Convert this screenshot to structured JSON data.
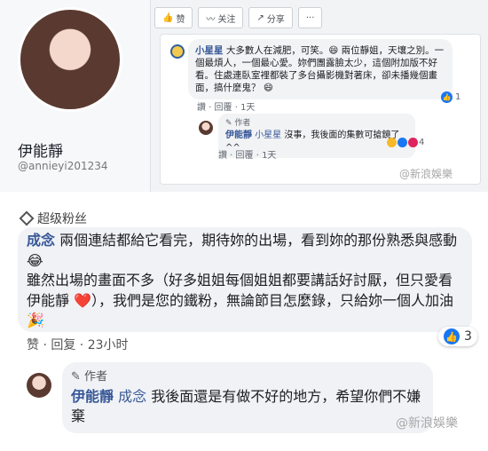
{
  "profile": {
    "name": "伊能靜",
    "handle": "@annieyi201234"
  },
  "toolbar": {
    "like": "赞",
    "follow": "关注",
    "share": "分享",
    "more": "···"
  },
  "post": {
    "commenter": "小星星",
    "text": " 大多數人在減肥，可笑。😄 兩位靜姐，天壤之別。一個最煩人，一個最心愛。妳們團露臉太少，這個附加版不好看。住處連臥室裡都裝了多台攝影機對著床，卻未播幾個畫面，搞什麼鬼？ 😄",
    "meta": "讚 · 回覆 · 1天",
    "likes": "1"
  },
  "reply1": {
    "author_tag": "作者",
    "name": "伊能靜",
    "mention": "小星星",
    "text": " 沒事，我後面的集數可搶鏡了^^",
    "meta": "讚 · 回覆 · 1天",
    "reactions": "4"
  },
  "watermark": "@新浪娛樂",
  "super_fan": {
    "label": "超级粉丝",
    "commenter": "成念",
    "text": " 兩個連結都給它看完，期待妳的出場，看到妳的那份熟悉與感動 😂\n雖然出場的畫面不多（好多姐姐每個姐姐都要講話好討厭，但只愛看伊能靜 ❤️），我們是您的鐵粉，無論節目怎麼錄，只給妳一個人加油 🎉",
    "meta": "赞 · 回复 · 23小时",
    "likes": "3"
  },
  "reply2": {
    "author_tag": "作者",
    "name": "伊能靜",
    "mention": "成念",
    "text": " 我後面還是有做不好的地方，希望你們不嫌棄"
  },
  "colors": {
    "link_blue": "#385898",
    "like_blue": "#1877f2",
    "bubble_gray": "#f0f2f5"
  }
}
